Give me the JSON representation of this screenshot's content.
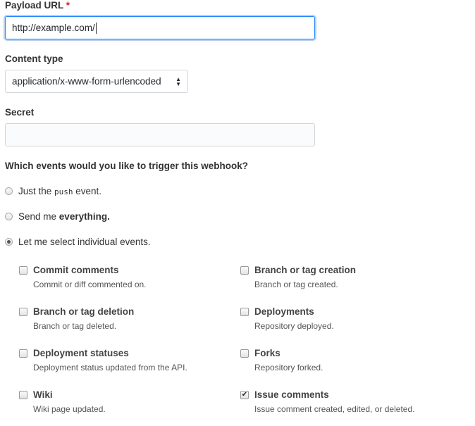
{
  "payload": {
    "label": "Payload URL",
    "required_mark": "*",
    "value": "http://example.com/"
  },
  "content_type": {
    "label": "Content type",
    "selected": "application/x-www-form-urlencoded"
  },
  "secret": {
    "label": "Secret",
    "value": ""
  },
  "events": {
    "question": "Which events would you like to trigger this webhook?",
    "options": [
      {
        "prefix": "Just the ",
        "code": "push",
        "suffix": " event.",
        "selected": false
      },
      {
        "prefix": "Send me ",
        "bold": "everything.",
        "selected": false
      },
      {
        "text": "Let me select individual events.",
        "selected": true
      }
    ],
    "items": [
      {
        "title": "Commit comments",
        "desc": "Commit or diff commented on.",
        "checked": false
      },
      {
        "title": "Branch or tag creation",
        "desc": "Branch or tag created.",
        "checked": false
      },
      {
        "title": "Branch or tag deletion",
        "desc": "Branch or tag deleted.",
        "checked": false
      },
      {
        "title": "Deployments",
        "desc": "Repository deployed.",
        "checked": false
      },
      {
        "title": "Deployment statuses",
        "desc": "Deployment status updated from the API.",
        "checked": false
      },
      {
        "title": "Forks",
        "desc": "Repository forked.",
        "checked": false
      },
      {
        "title": "Wiki",
        "desc": "Wiki page updated.",
        "checked": false
      },
      {
        "title": "Issue comments",
        "desc": "Issue comment created, edited, or deleted.",
        "checked": true
      }
    ]
  }
}
